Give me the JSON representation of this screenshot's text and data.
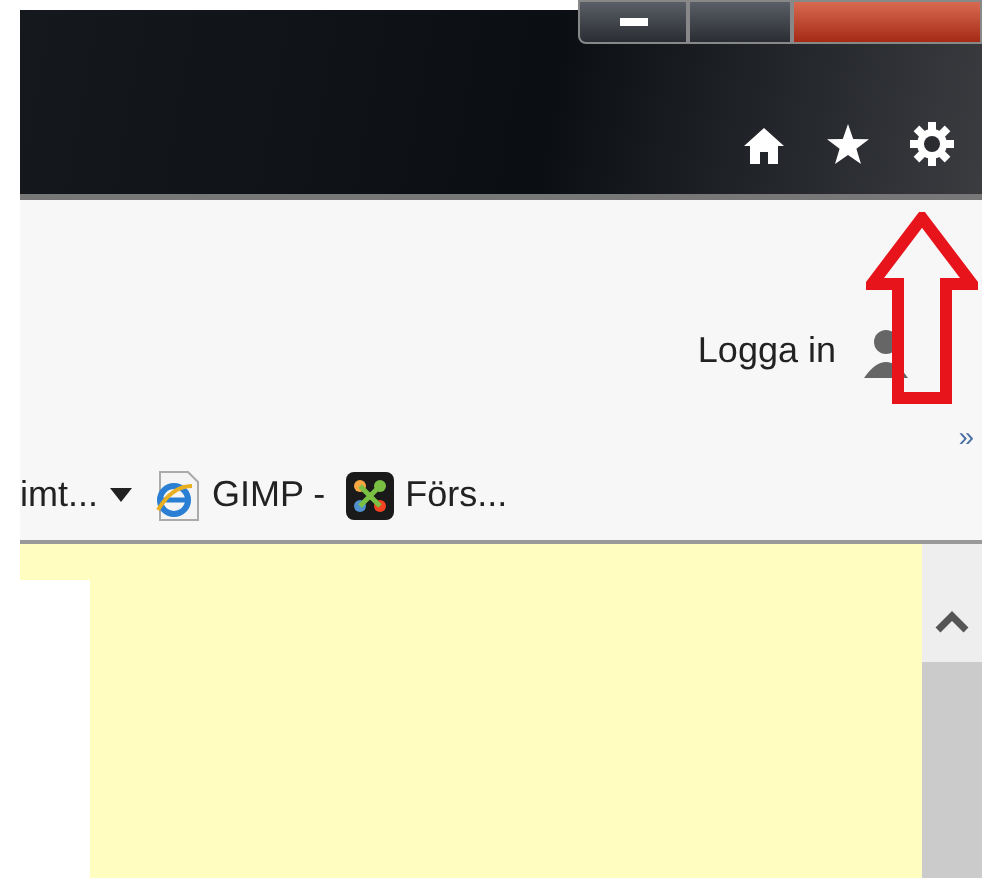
{
  "command_bar": {
    "login": "Logga in"
  },
  "favorites_bar": {
    "items": [
      {
        "label": "imt...",
        "kind": "dropdown"
      },
      {
        "label": "GIMP -",
        "kind": "ie-page"
      },
      {
        "label": "Förs...",
        "kind": "joomla"
      }
    ],
    "overflow": "»"
  }
}
